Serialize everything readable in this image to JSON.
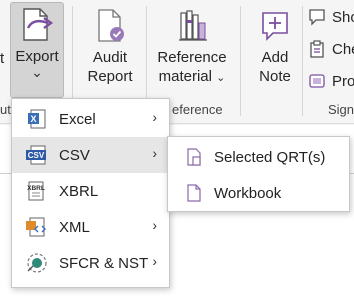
{
  "ribbon": {
    "partial_left_label": "t",
    "export": {
      "label": "Export",
      "caret": "⌄"
    },
    "audit_report": {
      "line1": "Audit",
      "line2": "Report"
    },
    "reference_material": {
      "line1": "Reference",
      "line2": "material",
      "caret": "⌄"
    },
    "add_note": {
      "line1": "Add",
      "line2": "Note"
    },
    "group_labels": {
      "left_cut": "ut",
      "reference": "eference",
      "right_cut": "Sign"
    },
    "small_buttons": [
      {
        "label": "Sho",
        "icon": "comment-icon"
      },
      {
        "label": "Che",
        "icon": "clipboard-icon"
      },
      {
        "label": "Pro",
        "icon": "stamp-icon"
      }
    ]
  },
  "export_menu": {
    "items": [
      {
        "label": "Excel",
        "icon": "excel-icon",
        "has_submenu": true
      },
      {
        "label": "CSV",
        "icon": "csv-icon",
        "has_submenu": true,
        "highlighted": true
      },
      {
        "label": "XBRL",
        "icon": "xbrl-icon",
        "has_submenu": false
      },
      {
        "label": "XML",
        "icon": "xml-icon",
        "has_submenu": true
      },
      {
        "label": "SFCR & NST",
        "icon": "sfcr-icon",
        "has_submenu": true
      }
    ],
    "arrow": "›"
  },
  "csv_submenu": {
    "items": [
      {
        "label": "Selected QRT(s)",
        "icon": "selected-qrt-icon"
      },
      {
        "label": "Workbook",
        "icon": "workbook-icon"
      }
    ]
  },
  "colors": {
    "accent_purple": "#7a4fa0",
    "highlight": "#e6e6e6",
    "export_pressed": "#d4d4d4"
  }
}
